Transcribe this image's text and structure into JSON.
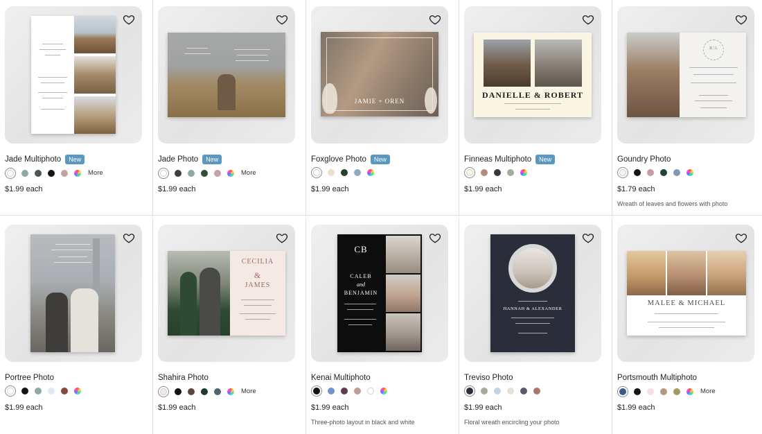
{
  "products": [
    {
      "name": "Jade Multiphoto",
      "badge": "New",
      "swatches": [
        "#ffffff",
        "#8fa9a8",
        "#4e5558",
        "#141414",
        "#c6a3a1",
        "rainbow"
      ],
      "more": "More",
      "price": "$1.99 each",
      "description": ""
    },
    {
      "name": "Jade Photo",
      "badge": "New",
      "swatches": [
        "#ffffff",
        "#3b3f42",
        "#8fa9a8",
        "#2f4e35",
        "#c6a3a1",
        "rainbow"
      ],
      "more": "More",
      "price": "$1.99 each",
      "description": ""
    },
    {
      "name": "Foxglove Photo",
      "badge": "New",
      "swatches": [
        "#ffffff",
        "#eadfcb",
        "#23402c",
        "#8faac0",
        "rainbow"
      ],
      "more": "",
      "price": "$1.99 each",
      "description": ""
    },
    {
      "name": "Finneas Multiphoto",
      "badge": "New",
      "swatches": [
        "#fbf5e3",
        "#b58b7b",
        "#36393b",
        "#a2ad9a",
        "rainbow"
      ],
      "more": "",
      "price": "$1.99 each",
      "description": ""
    },
    {
      "name": "Goundry Photo",
      "badge": "",
      "swatches": [
        "#f3f3f3",
        "#141414",
        "#c39ea1",
        "#1f4434",
        "#7f9bb4",
        "rainbow"
      ],
      "more": "",
      "price": "$1.79 each",
      "description": "Wreath of leaves and flowers with photo"
    },
    {
      "name": "Portree Photo",
      "badge": "",
      "swatches": [
        "#ffffff",
        "#141414",
        "#8fa9a8",
        "#dfe8f5",
        "#864a3d",
        "rainbow"
      ],
      "more": "",
      "price": "$1.99 each",
      "description": ""
    },
    {
      "name": "Shahira Photo",
      "badge": "",
      "swatches": [
        "#f4e9e4",
        "#141414",
        "#5e4440",
        "#1e3a2c",
        "#4f6470",
        "rainbow"
      ],
      "more": "More",
      "price": "$1.99 each",
      "description": ""
    },
    {
      "name": "Kenai Multiphoto",
      "badge": "",
      "swatches": [
        "#141414",
        "#7390d0",
        "#5f3c54",
        "#bf9d98",
        "#ffffff",
        "rainbow"
      ],
      "more": "",
      "price": "$1.99 each",
      "description": "Three-photo layout in black and white"
    },
    {
      "name": "Treviso Photo",
      "badge": "",
      "swatches": [
        "#2a2e3a",
        "#a4ad9d",
        "#c7d2e3",
        "#e6dfd8",
        "#585c68",
        "#a9766c"
      ],
      "more": "",
      "price": "$1.99 each",
      "description": "Floral wreath encircling your photo"
    },
    {
      "name": "Portsmouth Multiphoto",
      "badge": "",
      "swatches": [
        "#3a5a88",
        "#141414",
        "#f6dfe0",
        "#b8987c",
        "#a09a63",
        "rainbow"
      ],
      "more": "More",
      "price": "$1.99 each",
      "description": ""
    }
  ],
  "invitation_text": {
    "danielle": "DANIELLE & ROBERT",
    "jamie": "JAMIE + OREN",
    "cecilia": "CECILIA",
    "amp": "&",
    "james": "JAMES",
    "caleb": "CALEB",
    "and": "and",
    "benjamin": "BENJAMIN",
    "monogram": "CB",
    "hannah": "HANNAH & ALEXANDER",
    "malee": "MALEE & MICHAEL",
    "initials": "B | L"
  },
  "colors": {
    "badge": "#5a98c0",
    "divider": "#dedede",
    "tile_bg": "#e9e9e9"
  }
}
